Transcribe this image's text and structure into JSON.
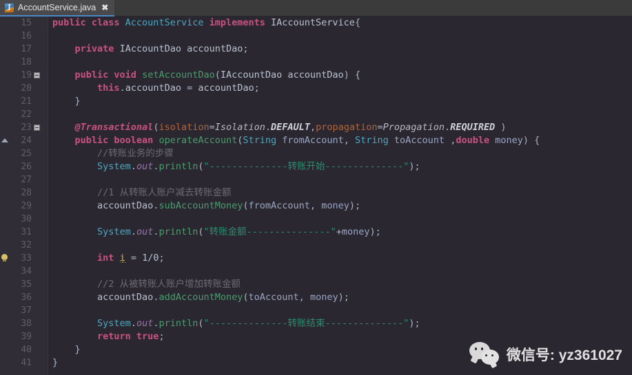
{
  "window": {
    "background_color": "#2b2730",
    "gutter_color": "#312d36",
    "tabbar_color": "#3b3b3b"
  },
  "tab": {
    "label": "AccountService.java",
    "icon": "java-file-icon",
    "icon_letter": "J",
    "close_label": "✖",
    "active_underline_color": "#4a88c7"
  },
  "editor": {
    "first_line_number": 15,
    "last_line_number": 41,
    "lines": [
      {
        "n": "15",
        "mark": "",
        "html": "<span class='kw'>public class </span><span class='typ'>AccountService</span><span class='kw'> implements </span><span class='id'>IAccountService</span><span class='pl'>{</span>"
      },
      {
        "n": "16",
        "mark": "",
        "html": ""
      },
      {
        "n": "17",
        "mark": "",
        "html": "    <span class='kw'>private</span> <span class='id'>IAccountDao accountDao</span><span class='pl'>;</span>"
      },
      {
        "n": "18",
        "mark": "",
        "html": ""
      },
      {
        "n": "19",
        "mark": "fold",
        "html": "    <span class='kw'>public void </span><span class='meth'>setAccountDao</span><span class='pl'>(</span><span class='id'>IAccountDao accountDao</span><span class='pl'>) {</span>"
      },
      {
        "n": "20",
        "mark": "",
        "html": "        <span class='kw'>this</span><span class='pl'>.</span><span class='id'>accountDao</span> <span class='pl'>=</span> <span class='id'>accountDao</span><span class='pl'>;</span>"
      },
      {
        "n": "21",
        "mark": "",
        "html": "    <span class='pl'>}</span>"
      },
      {
        "n": "22",
        "mark": "",
        "html": ""
      },
      {
        "n": "23",
        "mark": "fold",
        "html": "    <span class='ann'>@Transactional</span><span class='pl'>(</span><span class='annk'>isolation</span><span class='pl'>=</span><span class='cstn'>Isolation</span><span class='pl'>.</span><span class='cst'>DEFAULT</span><span class='pl'>,</span><span class='annk'>propagation</span><span class='pl'>=</span><span class='cstn'>Propagation</span><span class='pl'>.</span><span class='cst'>REQUIRED</span> <span class='pl'>)</span>"
      },
      {
        "n": "24",
        "mark": "arrow",
        "html": "    <span class='kw'>public boolean </span><span class='meth'>operateAccount</span><span class='pl'>(</span><span class='typ'>String</span> <span class='param'>fromAccount</span><span class='pl'>,</span> <span class='typ'>String</span> <span class='param'>toAccount</span> <span class='pl'>,</span><span class='kw'>double</span> <span class='param'>money</span><span class='pl'>) {</span>"
      },
      {
        "n": "25",
        "mark": "",
        "html": "        <span class='cmt'>//转账业务的步骤</span>"
      },
      {
        "n": "26",
        "mark": "",
        "html": "        <span class='typ'>System</span><span class='pl'>.</span><span class='fld'>out</span><span class='pl'>.</span><span class='meth'>println</span><span class='pl'>(</span><span class='str'>\"--------------转账开始--------------\"</span><span class='pl'>);</span>"
      },
      {
        "n": "27",
        "mark": "",
        "html": ""
      },
      {
        "n": "28",
        "mark": "",
        "html": "        <span class='cmt'>//1 从转账人账户减去转账金额</span>"
      },
      {
        "n": "29",
        "mark": "",
        "html": "        <span class='id'>accountDao</span><span class='pl'>.</span><span class='meth'>subAccountMoney</span><span class='pl'>(</span><span class='param'>fromAccount</span><span class='pl'>,</span> <span class='param'>money</span><span class='pl'>);</span>"
      },
      {
        "n": "30",
        "mark": "",
        "html": ""
      },
      {
        "n": "31",
        "mark": "",
        "html": "        <span class='typ'>System</span><span class='pl'>.</span><span class='fld'>out</span><span class='pl'>.</span><span class='meth'>println</span><span class='pl'>(</span><span class='str'>\"转账金额---------------\"</span><span class='pl'>+</span><span class='param'>money</span><span class='pl'>);</span>"
      },
      {
        "n": "32",
        "mark": "",
        "html": ""
      },
      {
        "n": "33",
        "mark": "bulb",
        "html": "        <span class='kw'>int</span> <span class='warnvar'>i</span> <span class='pl'>=</span> <span class='num'>1/0</span><span class='pl'>;</span>"
      },
      {
        "n": "34",
        "mark": "",
        "html": ""
      },
      {
        "n": "35",
        "mark": "",
        "html": "        <span class='cmt'>//2 从被转账人账户增加转账金额</span>"
      },
      {
        "n": "36",
        "mark": "",
        "html": "        <span class='id'>accountDao</span><span class='pl'>.</span><span class='meth'>addAccountMoney</span><span class='pl'>(</span><span class='param'>toAccount</span><span class='pl'>,</span> <span class='param'>money</span><span class='pl'>);</span>"
      },
      {
        "n": "37",
        "mark": "",
        "html": ""
      },
      {
        "n": "38",
        "mark": "",
        "html": "        <span class='typ'>System</span><span class='pl'>.</span><span class='fld'>out</span><span class='pl'>.</span><span class='meth'>println</span><span class='pl'>(</span><span class='str'>\"--------------转账结束--------------\"</span><span class='pl'>);</span>"
      },
      {
        "n": "39",
        "mark": "",
        "html": "        <span class='kw'>return true</span><span class='pl'>;</span>"
      },
      {
        "n": "40",
        "mark": "",
        "html": "    <span class='pl'>}</span>"
      },
      {
        "n": "41",
        "mark": "",
        "html": "<span class='pl'>}</span>"
      }
    ]
  },
  "watermark": {
    "text": "微信号: yz361027",
    "logo": "wechat-logo"
  }
}
